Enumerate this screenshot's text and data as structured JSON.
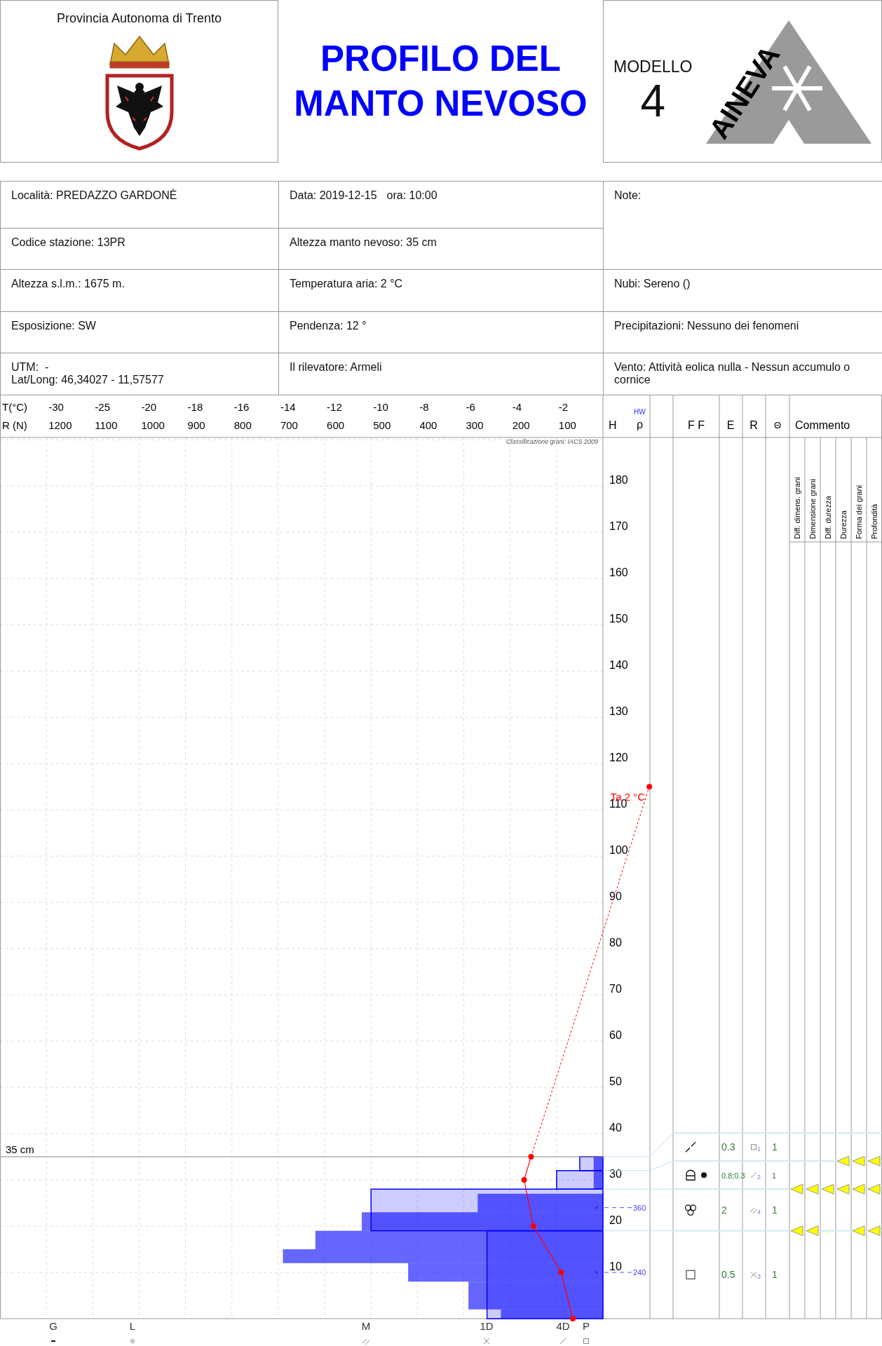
{
  "header": {
    "province": "Provincia Autonoma di Trento",
    "title": "PROFILO DEL MANTO NEVOSO",
    "model_label": "MODELLO",
    "model_number": "4",
    "logo_text": "AINEVA"
  },
  "info_cells": [
    {
      "texts": [
        "Località: PREDAZZO GARDONÈ"
      ],
      "kind": "inline",
      "tall": false
    },
    {
      "texts": [
        "Data: 2019-12-15",
        "ora: 10:00"
      ],
      "kind": "inline",
      "tall": false
    },
    {
      "texts": [
        "Note:"
      ],
      "kind": "inline",
      "tall": true
    },
    {
      "texts": [
        "Codice stazione: 13PR"
      ],
      "kind": "inline",
      "tall": false
    },
    {
      "texts": [
        "Altezza manto nevoso: 35 cm"
      ],
      "kind": "inline",
      "tall": false
    },
    {
      "texts": [
        "Altezza s.l.m.: 1675 m."
      ],
      "kind": "inline",
      "tall": false
    },
    {
      "texts": [
        "Temperatura aria: 2 °C"
      ],
      "kind": "inline",
      "tall": false
    },
    {
      "texts": [
        "Nubi: Sereno ()"
      ],
      "kind": "inline",
      "tall": false
    },
    {
      "texts": [
        "Esposizione: SW"
      ],
      "kind": "inline",
      "tall": false
    },
    {
      "texts": [
        "Pendenza: 12 °"
      ],
      "kind": "inline",
      "tall": false
    },
    {
      "texts": [
        "Precipitazioni: Nessuno dei fenomeni"
      ],
      "kind": "inline",
      "tall": false
    },
    {
      "texts": [
        "UTM:  -",
        "Lat/Long: 46,34027 - 11,57577"
      ],
      "kind": "stacked",
      "tall": false
    },
    {
      "texts": [
        "Il rilevatore: Armeli"
      ],
      "kind": "inline",
      "tall": false
    },
    {
      "texts": [
        "Vento: Attività eolica nulla - Nessun accumulo o cornice"
      ],
      "kind": "inline",
      "tall": false
    }
  ],
  "chart_area": {
    "temperature_axis": {
      "label": "T(°C)",
      "ticks": [
        "-30",
        "-25",
        "-20",
        "-18",
        "-16",
        "-14",
        "-12",
        "-10",
        "-8",
        "-6",
        "-4",
        "-2"
      ]
    },
    "resistance_axis": {
      "label": "R (N)",
      "ticks": [
        "1200",
        "1100",
        "1000",
        "900",
        "800",
        "700",
        "600",
        "500",
        "400",
        "300",
        "200",
        "100"
      ]
    },
    "column_headers": {
      "height": "H",
      "density_unit": "HW",
      "density": "ρ",
      "grain_form": "F F",
      "grain_size": "E",
      "hardness": "R",
      "wetness": "Θ",
      "comment": "Commento"
    },
    "comment_columns": [
      "Diff. dimens. grani",
      "Dimensione grani",
      "Diff. durezza",
      "Durezza",
      "Forma dei grani",
      "Profondità"
    ],
    "caption": "Classificazione grani: IACS 2009",
    "height_ticks": [
      "180",
      "170",
      "160",
      "150",
      "140",
      "130",
      "120",
      "110",
      "100",
      "90",
      "80",
      "70",
      "60",
      "50",
      "40",
      "30",
      "20",
      "10"
    ],
    "air_temperature_label": "Ta 2 °C",
    "snow_height_label": "35 cm",
    "density_labels": [
      "360",
      "240"
    ],
    "hardness_axis": [
      {
        "label": "G",
        "kind": "ice"
      },
      {
        "label": "L",
        "kind": "knife"
      },
      {
        "label": "M",
        "kind": "pencil"
      },
      {
        "label": "1D",
        "kind": "one_finger"
      },
      {
        "label": "4D",
        "kind": "four_fingers"
      },
      {
        "label": "P",
        "kind": "fist"
      }
    ],
    "layers": [
      {
        "grain_forms": [
          {
            "kind": "df"
          }
        ],
        "grain_size": "0.3",
        "hardness": {
          "kind": "fist",
          "code": "1"
        },
        "wetness": "1"
      },
      {
        "grain_forms": [
          {
            "kind": "fcxr"
          },
          {
            "kind": "rg"
          }
        ],
        "grain_size": "0.8;0.3",
        "hardness": {
          "kind": "four_fingers",
          "code": "2"
        },
        "wetness": "1"
      },
      {
        "grain_forms": [
          {
            "kind": "mf"
          }
        ],
        "grain_size": "2",
        "hardness": {
          "kind": "pencil",
          "code": "4"
        },
        "wetness": "1"
      },
      {
        "grain_forms": [
          {
            "kind": "fc"
          }
        ],
        "grain_size": "0.5",
        "hardness": {
          "kind": "one_finger",
          "code": "3"
        },
        "wetness": "1"
      }
    ],
    "interfaces": [
      {
        "flags": [
          false,
          false,
          false,
          true,
          true,
          true
        ]
      },
      {
        "flags": [
          true,
          true,
          true,
          true,
          true,
          true
        ]
      },
      {
        "flags": [
          true,
          true,
          false,
          false,
          true,
          true
        ]
      }
    ]
  }
}
